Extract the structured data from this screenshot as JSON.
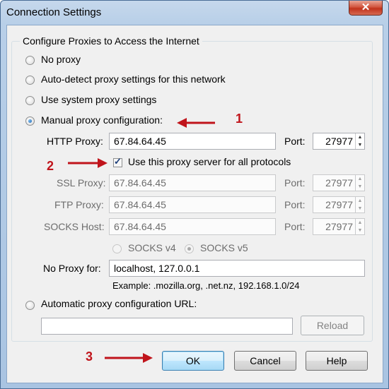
{
  "window": {
    "title": "Connection Settings",
    "close_glyph": "✕"
  },
  "group": {
    "label": "Configure Proxies to Access the Internet"
  },
  "radios": {
    "no_proxy": "No proxy",
    "auto_detect": "Auto-detect proxy settings for this network",
    "system": "Use system proxy settings",
    "manual": "Manual proxy configuration:",
    "auto_url": "Automatic proxy configuration URL:"
  },
  "http": {
    "label": "HTTP Proxy:",
    "value": "67.84.64.45",
    "port_label": "Port:",
    "port": "27977"
  },
  "use_all": {
    "label": "Use this proxy server for all protocols",
    "checked": true
  },
  "ssl": {
    "label": "SSL Proxy:",
    "value": "67.84.64.45",
    "port_label": "Port:",
    "port": "27977"
  },
  "ftp": {
    "label": "FTP Proxy:",
    "value": "67.84.64.45",
    "port_label": "Port:",
    "port": "27977"
  },
  "socks": {
    "label": "SOCKS Host:",
    "value": "67.84.64.45",
    "port_label": "Port:",
    "port": "27977"
  },
  "socks_version": {
    "v4": "SOCKS v4",
    "v5": "SOCKS v5"
  },
  "no_proxy_for": {
    "label": "No Proxy for:",
    "value": "localhost, 127.0.0.1",
    "example": "Example: .mozilla.org, .net.nz, 192.168.1.0/24"
  },
  "auto_url": {
    "value": "",
    "reload": "Reload"
  },
  "buttons": {
    "ok": "OK",
    "cancel": "Cancel",
    "help": "Help"
  },
  "annotations": {
    "one": "1",
    "two": "2",
    "three": "3",
    "color": "#c0141b"
  }
}
